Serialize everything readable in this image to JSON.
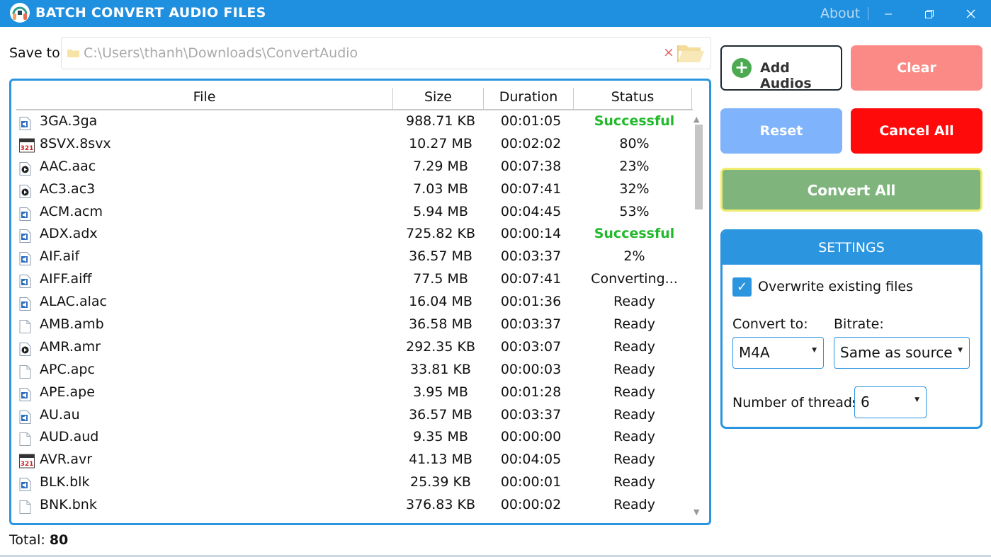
{
  "window": {
    "title": "BATCH CONVERT AUDIO FILES",
    "about": "About",
    "minimize_icon": "minimize-icon",
    "maximize_icon": "restore-icon",
    "close_icon": "close-icon"
  },
  "save_to": {
    "label": "Save to:",
    "path": "C:\\Users\\thanh\\Downloads\\ConvertAudio",
    "clear_symbol": "×"
  },
  "table": {
    "headers": {
      "file": "File",
      "size": "Size",
      "duration": "Duration",
      "status": "Status"
    },
    "rows": [
      {
        "icon": "audio-file",
        "file": "3GA.3ga",
        "size": "988.71 KB",
        "duration": "00:01:05",
        "status": "Successful"
      },
      {
        "icon": "mpc-file",
        "file": "8SVX.8svx",
        "size": "10.27 MB",
        "duration": "00:02:02",
        "status": "80%"
      },
      {
        "icon": "media-file",
        "file": "AAC.aac",
        "size": "7.29 MB",
        "duration": "00:07:38",
        "status": "23%"
      },
      {
        "icon": "media-file",
        "file": "AC3.ac3",
        "size": "7.03 MB",
        "duration": "00:07:41",
        "status": "32%"
      },
      {
        "icon": "audio-file",
        "file": "ACM.acm",
        "size": "5.94 MB",
        "duration": "00:04:45",
        "status": "53%"
      },
      {
        "icon": "audio-file",
        "file": "ADX.adx",
        "size": "725.82 KB",
        "duration": "00:00:14",
        "status": "Successful"
      },
      {
        "icon": "audio-file",
        "file": "AIF.aif",
        "size": "36.57 MB",
        "duration": "00:03:37",
        "status": "2%"
      },
      {
        "icon": "audio-file",
        "file": "AIFF.aiff",
        "size": "77.5 MB",
        "duration": "00:07:41",
        "status": "Converting..."
      },
      {
        "icon": "audio-file",
        "file": "ALAC.alac",
        "size": "16.04 MB",
        "duration": "00:01:36",
        "status": "Ready"
      },
      {
        "icon": "blank-file",
        "file": "AMB.amb",
        "size": "36.58 MB",
        "duration": "00:03:37",
        "status": "Ready"
      },
      {
        "icon": "media-file",
        "file": "AMR.amr",
        "size": "292.35 KB",
        "duration": "00:03:07",
        "status": "Ready"
      },
      {
        "icon": "blank-file",
        "file": "APC.apc",
        "size": "33.81 KB",
        "duration": "00:00:03",
        "status": "Ready"
      },
      {
        "icon": "audio-file",
        "file": "APE.ape",
        "size": "3.95 MB",
        "duration": "00:01:28",
        "status": "Ready"
      },
      {
        "icon": "audio-file",
        "file": "AU.au",
        "size": "36.57 MB",
        "duration": "00:03:37",
        "status": "Ready"
      },
      {
        "icon": "blank-file",
        "file": "AUD.aud",
        "size": "9.35 MB",
        "duration": "00:00:00",
        "status": "Ready"
      },
      {
        "icon": "mpc-file",
        "file": "AVR.avr",
        "size": "41.13 MB",
        "duration": "00:04:05",
        "status": "Ready"
      },
      {
        "icon": "audio-file",
        "file": "BLK.blk",
        "size": "25.39 KB",
        "duration": "00:00:01",
        "status": "Ready"
      },
      {
        "icon": "blank-file",
        "file": "BNK.bnk",
        "size": "376.83 KB",
        "duration": "00:00:02",
        "status": "Ready"
      }
    ]
  },
  "footer": {
    "total_label": "Total:",
    "total_value": "80"
  },
  "buttons": {
    "add": "Add Audios",
    "clear": "Clear",
    "reset": "Reset",
    "cancel_all": "Cancel All",
    "convert_all": "Convert All"
  },
  "settings": {
    "title": "SETTINGS",
    "overwrite_label": "Overwrite existing files",
    "overwrite_checked": true,
    "convert_to_label": "Convert to:",
    "convert_to_value": "M4A",
    "bitrate_label": "Bitrate:",
    "bitrate_value": "Same as source",
    "threads_label": "Number of threads:",
    "threads_value": "6"
  },
  "colors": {
    "accent": "#2b95e0",
    "titlebar": "#1f8fe0",
    "success": "#22b92c",
    "clear": "#fb8a86",
    "reset": "#7fb3fb",
    "cancel": "#ff0a0a",
    "convert": "#7fb47d",
    "convert_border": "#efec6f"
  }
}
